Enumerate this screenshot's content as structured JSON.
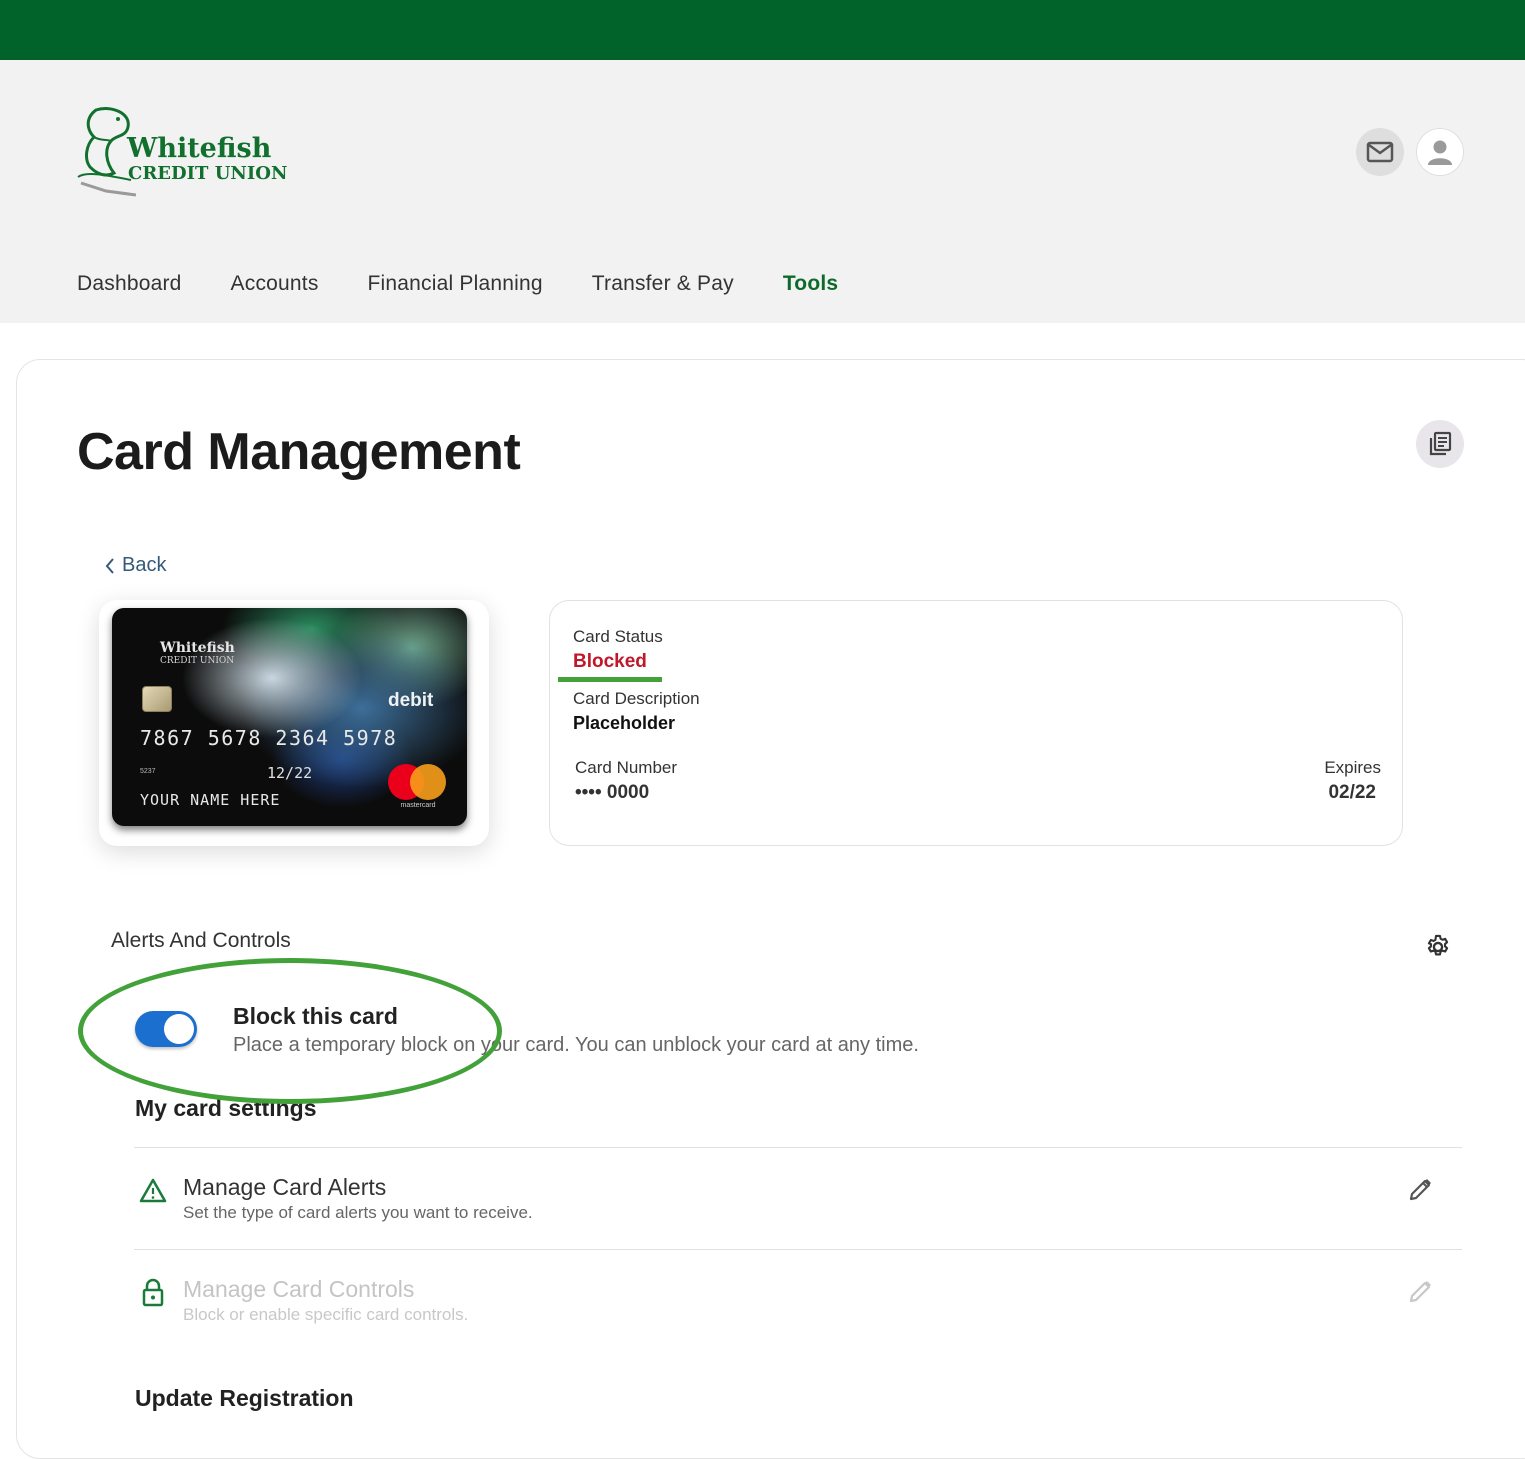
{
  "brand": {
    "name_line1": "Whitefish",
    "name_line2": "CREDIT UNION",
    "primary_color": "#01622a",
    "accent_color": "#0e6a2c"
  },
  "header": {
    "icons": [
      "mail-icon",
      "user-avatar-icon"
    ]
  },
  "nav": {
    "items": [
      {
        "label": "Dashboard",
        "active": false
      },
      {
        "label": "Accounts",
        "active": false
      },
      {
        "label": "Financial Planning",
        "active": false
      },
      {
        "label": "Transfer & Pay",
        "active": false
      },
      {
        "label": "Tools",
        "active": true
      }
    ]
  },
  "page": {
    "title": "Card Management",
    "docs_icon": "documents-icon",
    "back_label": "Back"
  },
  "card_image": {
    "issuer_line1": "Whitefish",
    "issuer_line2": "CREDIT UNION",
    "type_label": "debit",
    "number": "7867 5678 2364 5978",
    "small_code": "5237",
    "valid_thru": "12/22",
    "holder_name": "YOUR NAME HERE",
    "network": "mastercard"
  },
  "card_info": {
    "status_label": "Card Status",
    "status_value": "Blocked",
    "status_color": "#c0182a",
    "description_label": "Card Description",
    "description_value": "Placeholder",
    "number_label": "Card Number",
    "number_value": "•••• 0000",
    "expires_label": "Expires",
    "expires_value": "02/22"
  },
  "alerts_controls": {
    "section_title": "Alerts And Controls",
    "settings_icon": "gear-icon",
    "block_toggle": {
      "title": "Block this card",
      "description": "Place a temporary block on your card. You can unblock your card at any time.",
      "on": true
    },
    "my_settings_title": "My card settings",
    "rows": [
      {
        "title": "Manage Card Alerts",
        "description": "Set the type of card alerts you want to receive.",
        "icon": "warning-triangle-icon",
        "disabled": false
      },
      {
        "title": "Manage Card Controls",
        "description": "Block or enable specific card controls.",
        "icon": "lock-icon",
        "disabled": true
      }
    ],
    "next_section_title": "Update Registration"
  }
}
